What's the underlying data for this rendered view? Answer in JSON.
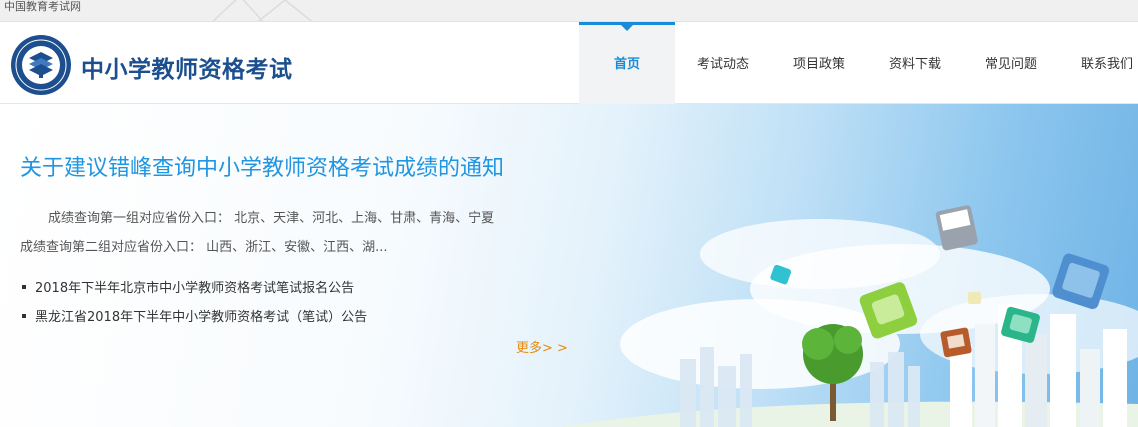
{
  "topbar": {
    "site_name": "中国教育考试网"
  },
  "header": {
    "site_title": "中小学教师资格考试",
    "nav": [
      {
        "label": "首页",
        "active": true
      },
      {
        "label": "考试动态"
      },
      {
        "label": "项目政策"
      },
      {
        "label": "资料下载"
      },
      {
        "label": "常见问题"
      },
      {
        "label": "联系我们"
      }
    ]
  },
  "featured": {
    "title": "关于建议错峰查询中小学教师资格考试成绩的通知",
    "summary_line1": "成绩查询第一组对应省份入口： 北京、天津、河北、上海、甘肃、青海、宁夏",
    "summary_line2": "成绩查询第二组对应省份入口： 山西、浙江、安徽、江西、湖..."
  },
  "news": [
    {
      "text": "2018年下半年北京市中小学教师资格考试笔试报名公告"
    },
    {
      "text": "黑龙江省2018年下半年中小学教师资格考试（笔试）公告"
    }
  ],
  "more_label": "更多> >",
  "colors": {
    "accent": "#1a8bd8",
    "title_blue": "#2196e0",
    "brand": "#1b4f8f",
    "more": "#e58a10"
  }
}
